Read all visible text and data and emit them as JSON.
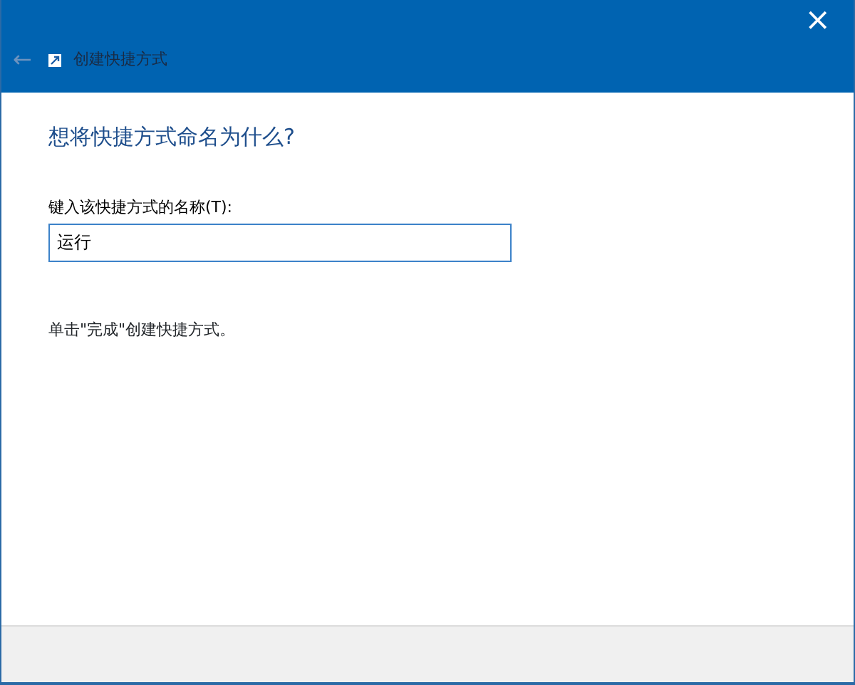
{
  "window": {
    "title": "创建快捷方式",
    "close": "×",
    "back": "←"
  },
  "heading": "想将快捷方式命名为什么?",
  "name_field": {
    "label": "键入该快捷方式的名称(T):",
    "value": "运行"
  },
  "hint": "单击\"完成\"创建快捷方式。"
}
